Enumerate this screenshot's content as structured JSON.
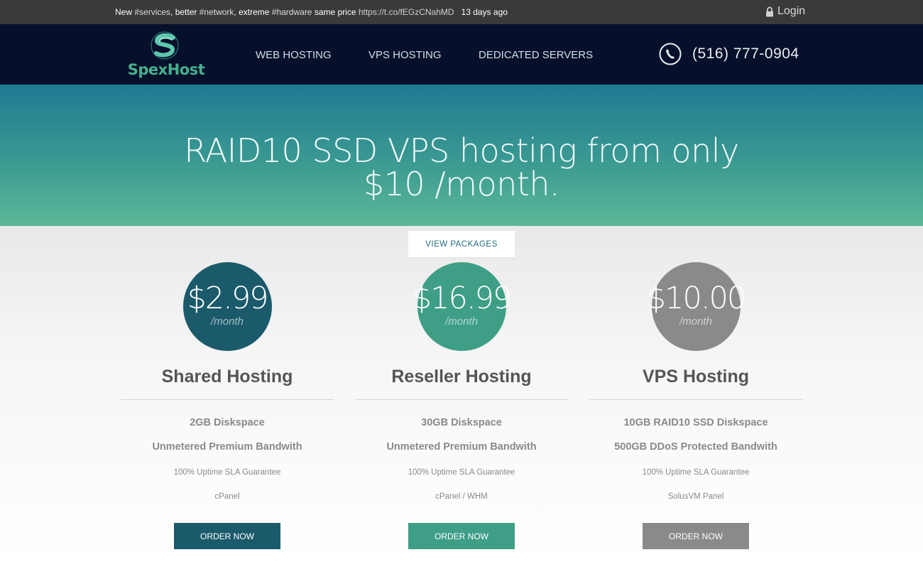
{
  "topbar": {
    "tweet_parts": [
      "New ",
      "#services",
      ", better ",
      "#network",
      ", extreme ",
      "#hardware",
      " same price "
    ],
    "tweet_link": "https://t.co/fEGzCNahMD",
    "tweet_age": "13 days ago",
    "login_label": "Login",
    "login_icon": "lock-icon"
  },
  "header": {
    "logo_text": "SpexHost",
    "nav": [
      "WEB HOSTING",
      "VPS HOSTING",
      "DEDICATED SERVERS"
    ],
    "phone_icon": "phone-icon",
    "phone": "(516) 777-0904"
  },
  "hero": {
    "title": "RAID10 SSD VPS hosting from only $10 /month.",
    "cta": "VIEW PACKAGES"
  },
  "plans": [
    {
      "price": "$2.99",
      "per": "/month",
      "name": "Shared Hosting",
      "features": [
        "2GB Diskspace",
        "Unmetered Premium Bandwith",
        "100% Uptime SLA Guarantee",
        "cPanel"
      ],
      "order": "ORDER NOW",
      "color": "#1b5a6b"
    },
    {
      "price": "$16.99",
      "per": "/month",
      "name": "Reseller Hosting",
      "features": [
        "30GB Diskspace",
        "Unmetered Premium Bandwith",
        "100% Uptime SLA Guarantee",
        "cPanel / WHM"
      ],
      "order": "ORDER NOW",
      "color": "#3e9f86"
    },
    {
      "price": "$10.00",
      "per": "/month",
      "name": "VPS Hosting",
      "features": [
        "10GB RAID10 SSD Diskspace",
        "500GB DDoS Protected Bandwith",
        "100% Uptime SLA Guarantee",
        "SolusVM Panel"
      ],
      "order": "ORDER NOW",
      "color": "#8a8a8a"
    }
  ],
  "colors": {
    "topbar": "#3a3a3a",
    "header": "#07102a",
    "brand": "#46b08f",
    "hero_top": "#1f7b93",
    "hero_bottom": "#5cb897"
  }
}
